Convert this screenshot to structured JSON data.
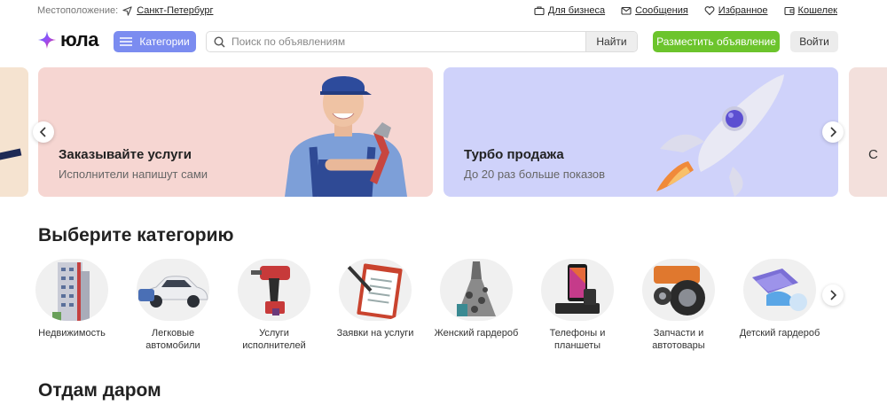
{
  "topbar": {
    "location_label": "Местоположение:",
    "location_value": "Санкт-Петербург",
    "links": [
      "Для бизнеса",
      "Сообщения",
      "Избранное",
      "Кошелек"
    ]
  },
  "header": {
    "logo": "юла",
    "categories_button": "Категории",
    "search_placeholder": "Поиск по объявлениям",
    "search_button": "Найти",
    "post_button": "Разместить объявление",
    "login_button": "Войти"
  },
  "banners": [
    {
      "title": "Заказывайте услуги",
      "subtitle": "Исполнители напишут сами"
    },
    {
      "title": "Турбо продажа",
      "subtitle": "До 20 раз больше показов"
    },
    {
      "title": "С",
      "subtitle": ""
    }
  ],
  "categories_section": {
    "title": "Выберите категорию",
    "items": [
      {
        "label": "Недвижимость",
        "icon": "building-icon"
      },
      {
        "label": "Легковые автомобили",
        "icon": "car-icon"
      },
      {
        "label": "Услуги исполнителей",
        "icon": "drill-icon"
      },
      {
        "label": "Заявки на услуги",
        "icon": "clipboard-icon"
      },
      {
        "label": "Женский гардероб",
        "icon": "dress-icon"
      },
      {
        "label": "Телефоны и планшеты",
        "icon": "phone-icon"
      },
      {
        "label": "Запчасти и автотовары",
        "icon": "wheel-icon"
      },
      {
        "label": "Детский гардероб",
        "icon": "kids-clothes-icon"
      }
    ]
  },
  "free_section": {
    "title": "Отдам даром"
  },
  "colors": {
    "accent": "#7b8cf0",
    "post_green": "#6cc42c",
    "banner_services": "#f6d6d2",
    "banner_turbo": "#cfd2fa"
  }
}
